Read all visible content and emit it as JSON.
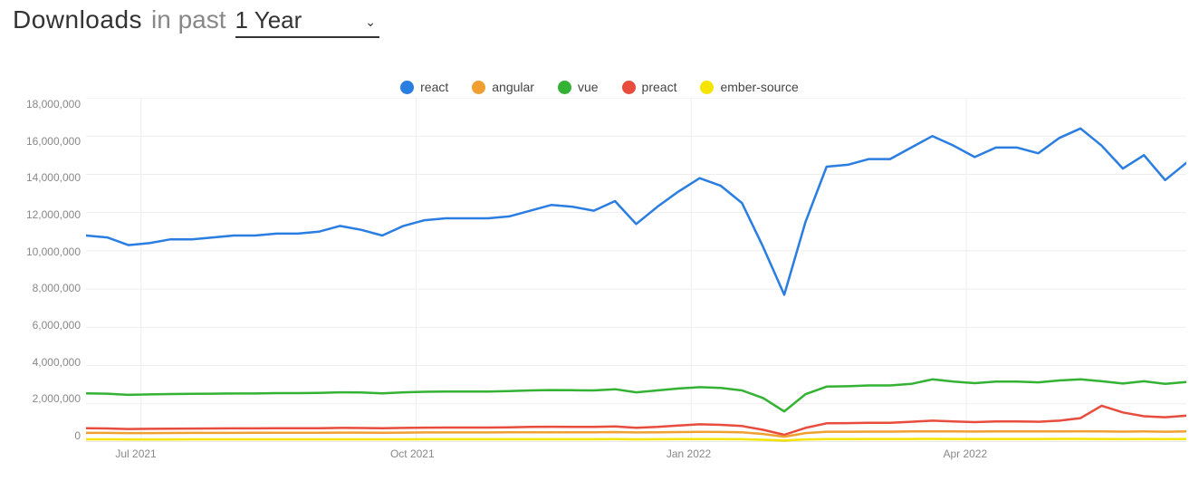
{
  "header": {
    "bold": "Downloads",
    "thin": "in past",
    "selected": "1 Year"
  },
  "legend": [
    {
      "name": "react",
      "color": "#2a7de1"
    },
    {
      "name": "angular",
      "color": "#f0a030"
    },
    {
      "name": "vue",
      "color": "#33b233"
    },
    {
      "name": "preact",
      "color": "#e74c3c"
    },
    {
      "name": "ember-source",
      "color": "#f5e400"
    }
  ],
  "chart_data": {
    "type": "line",
    "title": "Downloads in past 1 Year",
    "xlabel": "",
    "ylabel": "",
    "ylim": [
      0,
      18000000
    ],
    "y_ticks": [
      0,
      2000000,
      4000000,
      6000000,
      8000000,
      10000000,
      12000000,
      14000000,
      16000000,
      18000000
    ],
    "y_tick_labels": [
      "0",
      "2,000,000",
      "4,000,000",
      "6,000,000",
      "8,000,000",
      "10,000,000",
      "12,000,000",
      "14,000,000",
      "16,000,000",
      "18,000,000"
    ],
    "x_ticks": [
      "Jul 2021",
      "Oct 2021",
      "Jan 2022",
      "Apr 2022"
    ],
    "x_tick_pos": [
      0.05,
      0.3,
      0.55,
      0.8
    ],
    "n_points": 53,
    "series": [
      {
        "name": "react",
        "color": "#2a7de1",
        "values": [
          10800000,
          10700000,
          10300000,
          10400000,
          10600000,
          10600000,
          10700000,
          10800000,
          10800000,
          10900000,
          10900000,
          11000000,
          11300000,
          11100000,
          10800000,
          11300000,
          11600000,
          11700000,
          11700000,
          11700000,
          11800000,
          12100000,
          12400000,
          12300000,
          12100000,
          12600000,
          11400000,
          12300000,
          13100000,
          13800000,
          13400000,
          12500000,
          10200000,
          7700000,
          11500000,
          14400000,
          14500000,
          14800000,
          14800000,
          15400000,
          16000000,
          15500000,
          14900000,
          15400000,
          15400000,
          15100000,
          15900000,
          16400000,
          15500000,
          14300000,
          15000000,
          13700000,
          14600000
        ]
      },
      {
        "name": "angular",
        "color": "#f0a030",
        "values": [
          480000,
          480000,
          470000,
          470000,
          475000,
          480000,
          480000,
          480000,
          485000,
          490000,
          490000,
          490000,
          495000,
          495000,
          490000,
          495000,
          500000,
          500000,
          500000,
          500000,
          505000,
          510000,
          510000,
          510000,
          510000,
          520000,
          500000,
          510000,
          520000,
          530000,
          525000,
          510000,
          420000,
          280000,
          470000,
          540000,
          540000,
          545000,
          545000,
          555000,
          560000,
          555000,
          550000,
          555000,
          555000,
          552000,
          560000,
          565000,
          560000,
          545000,
          555000,
          540000,
          555000
        ]
      },
      {
        "name": "vue",
        "color": "#33b233",
        "values": [
          2550000,
          2530000,
          2470000,
          2490000,
          2510000,
          2520000,
          2530000,
          2540000,
          2540000,
          2560000,
          2560000,
          2570000,
          2600000,
          2590000,
          2550000,
          2600000,
          2630000,
          2640000,
          2640000,
          2640000,
          2660000,
          2700000,
          2720000,
          2710000,
          2700000,
          2760000,
          2600000,
          2700000,
          2800000,
          2870000,
          2830000,
          2700000,
          2300000,
          1600000,
          2500000,
          2900000,
          2920000,
          2960000,
          2960000,
          3040000,
          3280000,
          3160000,
          3080000,
          3160000,
          3160000,
          3120000,
          3220000,
          3280000,
          3180000,
          3060000,
          3180000,
          3040000,
          3140000
        ]
      },
      {
        "name": "preact",
        "color": "#e74c3c",
        "values": [
          720000,
          710000,
          680000,
          690000,
          700000,
          705000,
          710000,
          715000,
          715000,
          720000,
          720000,
          725000,
          740000,
          735000,
          720000,
          740000,
          755000,
          760000,
          760000,
          760000,
          770000,
          790000,
          800000,
          795000,
          790000,
          820000,
          750000,
          790000,
          860000,
          930000,
          900000,
          840000,
          640000,
          380000,
          740000,
          980000,
          990000,
          1010000,
          1010000,
          1060000,
          1120000,
          1080000,
          1040000,
          1080000,
          1080000,
          1060000,
          1120000,
          1250000,
          1900000,
          1550000,
          1350000,
          1300000,
          1380000
        ]
      },
      {
        "name": "ember-source",
        "color": "#f5e400",
        "values": [
          140000,
          140000,
          138000,
          138000,
          139000,
          140000,
          140000,
          140000,
          141000,
          141000,
          141000,
          142000,
          143000,
          143000,
          142000,
          143000,
          145000,
          145000,
          145000,
          145000,
          146000,
          148000,
          148000,
          148000,
          148000,
          150000,
          144000,
          148000,
          152000,
          156000,
          154000,
          148000,
          120000,
          80000,
          138000,
          158000,
          158000,
          160000,
          160000,
          162000,
          164000,
          162000,
          160000,
          162000,
          162000,
          161000,
          164000,
          166000,
          163000,
          158000,
          163000,
          158000,
          163000
        ]
      }
    ]
  }
}
